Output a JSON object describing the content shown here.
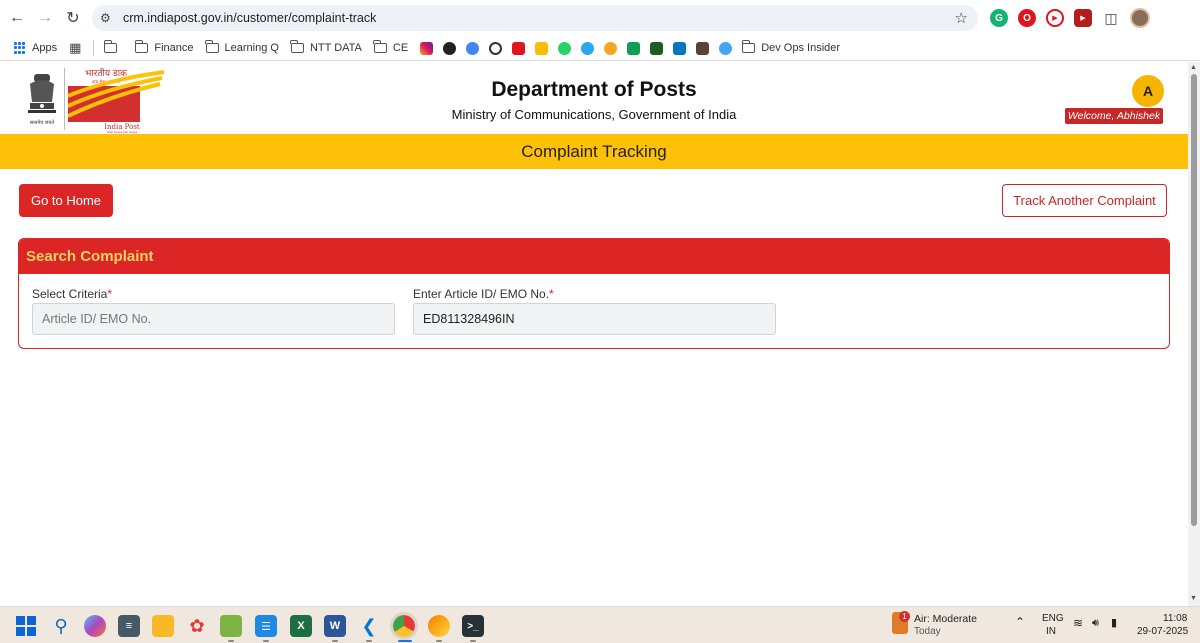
{
  "browser": {
    "url": "crm.indiapost.gov.in/customer/complaint-track",
    "bookmarks": {
      "apps_label": "Apps",
      "folders": [
        "Finance",
        "Learning Q",
        "NTT DATA",
        "CE"
      ],
      "last_folder": "Dev Ops Insider"
    }
  },
  "site": {
    "emblem_caption": "सत्यमेव जयते",
    "logo_hindi": "भारतीय डाक",
    "logo_tagline_hindi": "डाक सेवा–जन सेवा",
    "logo_label": "India Post",
    "logo_tagline": "Dak Sewa-Jan Sewa",
    "title": "Department of Posts",
    "subtitle": "Ministry of Communications, Government of India",
    "avatar_initial": "A",
    "welcome": "Welcome, Abhishek",
    "banner": "Complaint Tracking"
  },
  "actions": {
    "home_label": "Go to Home",
    "track_another_label": "Track Another Complaint"
  },
  "search": {
    "header": "Search Complaint",
    "criteria_label": "Select Criteria",
    "criteria_placeholder": "Article ID/ EMO No.",
    "article_label": "Enter Article ID/ EMO No.",
    "article_value": "ED811328496IN",
    "required_mark": "*"
  },
  "taskbar": {
    "weather_badge": "1",
    "weather_title": "Air: Moderate",
    "weather_sub": "Today",
    "lang_top": "ENG",
    "lang_bottom": "IN",
    "time": "11:08",
    "date": "29-07-2025"
  },
  "colors": {
    "brand_red": "#dc2626",
    "band_yellow": "#ffc107",
    "header_text_yellow": "#ffd166"
  }
}
